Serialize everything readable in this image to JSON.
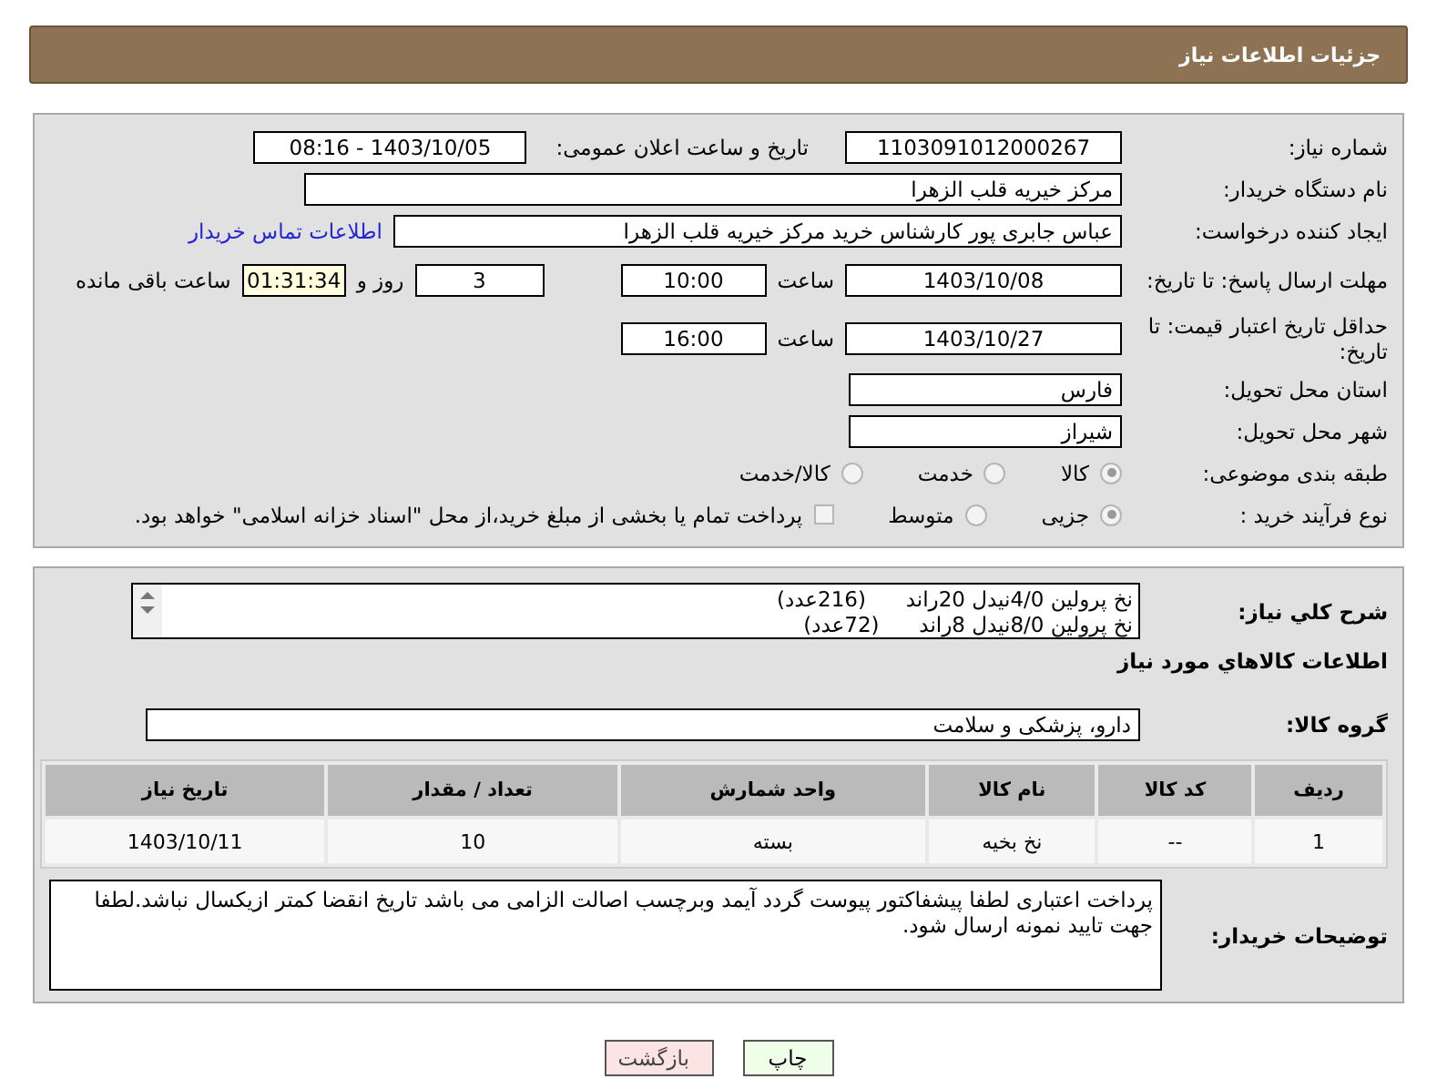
{
  "header": {
    "title": "جزئیات اطلاعات نیاز"
  },
  "need_number": {
    "label": "شماره نیاز:",
    "value": "1103091012000267"
  },
  "announce": {
    "label": "تاریخ و ساعت اعلان عمومی:",
    "value": "1403/10/05 - 08:16"
  },
  "buyer": {
    "label": "نام دستگاه خریدار:",
    "value": "مرکز خیریه قلب الزهرا"
  },
  "requester": {
    "label": "ایجاد کننده درخواست:",
    "value": "عباس جابری پور کارشناس خرید مرکز خیریه قلب الزهرا",
    "link": "اطلاعات تماس خریدار"
  },
  "deadline": {
    "label": "مهلت ارسال پاسخ: تا تاریخ:",
    "date": "1403/10/08",
    "time_label": "ساعت",
    "time": "10:00",
    "days": "3",
    "days_label": "روز و",
    "remaining": "01:31:34",
    "remaining_label": "ساعت باقی مانده"
  },
  "validity": {
    "label": "حداقل تاریخ اعتبار قیمت: تا تاریخ:",
    "date": "1403/10/27",
    "time_label": "ساعت",
    "time": "16:00"
  },
  "province": {
    "label": "استان محل تحویل:",
    "value": "فارس"
  },
  "city": {
    "label": "شهر محل تحویل:",
    "value": "شیراز"
  },
  "category": {
    "label": "طبقه بندی موضوعی:",
    "options": [
      {
        "label": "کالا",
        "selected": true
      },
      {
        "label": "خدمت",
        "selected": false
      },
      {
        "label": "کالا/خدمت",
        "selected": false
      }
    ]
  },
  "process": {
    "label": "نوع فرآیند خرید :",
    "options": [
      {
        "label": "جزیی",
        "selected": true
      },
      {
        "label": "متوسط",
        "selected": false
      }
    ],
    "checkbox": {
      "label": "پرداخت تمام یا بخشی از مبلغ خرید،از محل \"اسناد خزانه اسلامی\" خواهد بود.",
      "checked": false
    }
  },
  "description": {
    "label": "شرح کلي نياز:",
    "lines": [
      "نخ پرولین 4/0نیدل 20راند      (216عدد)",
      "نخ پرولین 8/0نیدل 8راند      (72عدد)"
    ]
  },
  "items_heading": "اطلاعات کالاهاي مورد نياز",
  "group": {
    "label": "گروه کالا:",
    "value": "دارو، پزشکی و سلامت"
  },
  "table": {
    "columns": [
      "ردیف",
      "کد کالا",
      "نام کالا",
      "واحد شمارش",
      "تعداد / مقدار",
      "تاریخ نیاز"
    ],
    "rows": [
      [
        "1",
        "--",
        "نخ بخیه",
        "بسته",
        "10",
        "1403/10/11"
      ]
    ]
  },
  "notes": {
    "label": "توضیحات خریدار:",
    "value": "پرداخت اعتباری لطفا پیشفاکتور پیوست گردد آیمد وبرچسب اصالت الزامی می باشد تاریخ انقضا کمتر ازیکسال نباشد.لطفا جهت تایید نمونه ارسال شود."
  },
  "buttons": [
    {
      "label": "چاپ",
      "kind": "print"
    },
    {
      "label": "بازگشت",
      "kind": "back"
    }
  ]
}
